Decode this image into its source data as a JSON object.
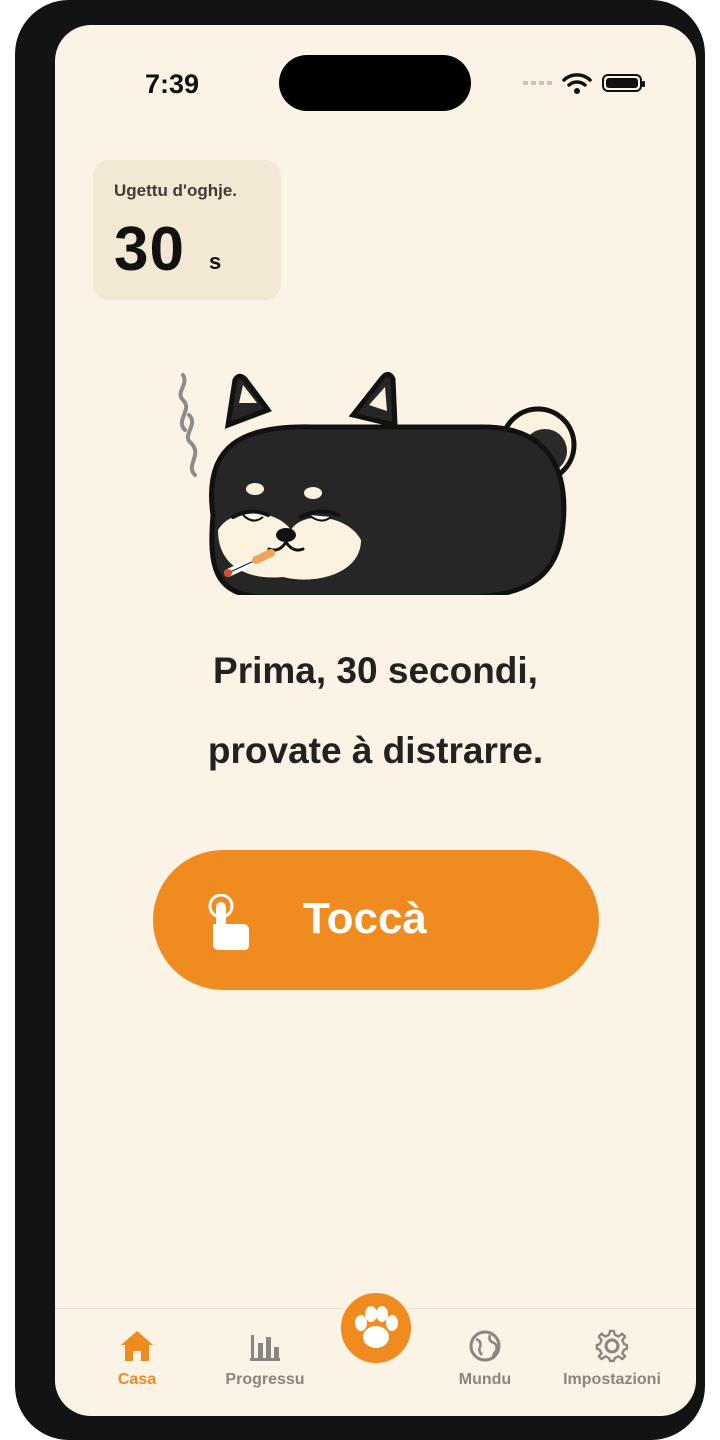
{
  "status_bar": {
    "time": "7:39"
  },
  "daily_card": {
    "label": "Ugettu d'oghje.",
    "value": "30",
    "unit": "s"
  },
  "prompt": {
    "line1": "Prima, 30 secondi,",
    "line2": "provate à distrarre."
  },
  "tap_button": {
    "label": "Toccà",
    "icon": "pointing-hand-icon"
  },
  "tabs": [
    {
      "label": "Casa",
      "icon": "home-icon",
      "active": true
    },
    {
      "label": "Progressu",
      "icon": "bar-chart-icon",
      "active": false
    },
    {
      "label": "",
      "icon": "paw-icon",
      "active": false
    },
    {
      "label": "Mundu",
      "icon": "globe-icon",
      "active": false
    },
    {
      "label": "Impostazioni",
      "icon": "gear-icon",
      "active": false
    }
  ],
  "colors": {
    "accent": "#ef8b1f",
    "background": "#faf3e6",
    "card": "#f3e8d3",
    "text": "#222222"
  }
}
